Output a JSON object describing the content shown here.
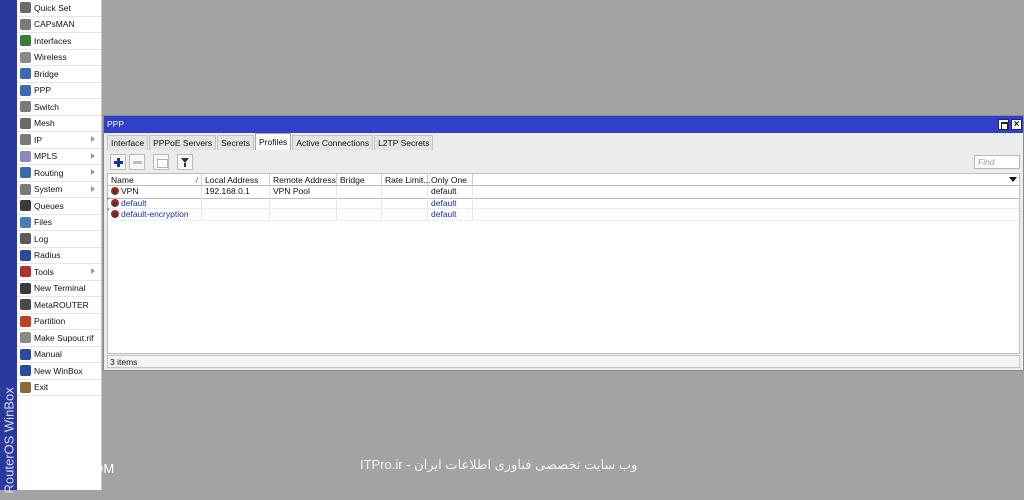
{
  "brand": {
    "text": "RouterOS WinBox"
  },
  "menu": {
    "items": [
      {
        "label": "Quick Set",
        "icon": "quick-set-icon",
        "color": "#6a6a6a",
        "submenu": false
      },
      {
        "label": "CAPsMAN",
        "icon": "capsman-icon",
        "color": "#7a7a7a",
        "submenu": false
      },
      {
        "label": "Interfaces",
        "icon": "interfaces-icon",
        "color": "#3a7a3a",
        "submenu": false
      },
      {
        "label": "Wireless",
        "icon": "wireless-icon",
        "color": "#8a8a8a",
        "submenu": false
      },
      {
        "label": "Bridge",
        "icon": "bridge-icon",
        "color": "#3a6ab0",
        "submenu": false
      },
      {
        "label": "PPP",
        "icon": "ppp-icon",
        "color": "#3a6ab0",
        "submenu": false
      },
      {
        "label": "Switch",
        "icon": "switch-icon",
        "color": "#7a7a7a",
        "submenu": false
      },
      {
        "label": "Mesh",
        "icon": "mesh-icon",
        "color": "#6a6a6a",
        "submenu": false
      },
      {
        "label": "IP",
        "icon": "ip-icon",
        "color": "#7a7a7a",
        "submenu": true
      },
      {
        "label": "MPLS",
        "icon": "mpls-icon",
        "color": "#8a8ac0",
        "submenu": true
      },
      {
        "label": "Routing",
        "icon": "routing-icon",
        "color": "#3a6ab0",
        "submenu": true
      },
      {
        "label": "System",
        "icon": "system-icon",
        "color": "#7a7a7a",
        "submenu": true
      },
      {
        "label": "Queues",
        "icon": "queues-icon",
        "color": "#3a3a3a",
        "submenu": false
      },
      {
        "label": "Files",
        "icon": "files-icon",
        "color": "#4a7ac0",
        "submenu": false
      },
      {
        "label": "Log",
        "icon": "log-icon",
        "color": "#5a5a5a",
        "submenu": false
      },
      {
        "label": "Radius",
        "icon": "radius-icon",
        "color": "#2a4aa0",
        "submenu": false
      },
      {
        "label": "Tools",
        "icon": "tools-icon",
        "color": "#b03030",
        "submenu": true
      },
      {
        "label": "New Terminal",
        "icon": "terminal-icon",
        "color": "#3a3a3a",
        "submenu": false
      },
      {
        "label": "MetaROUTER",
        "icon": "metarouter-icon",
        "color": "#4a4a4a",
        "submenu": false
      },
      {
        "label": "Partition",
        "icon": "partition-icon",
        "color": "#c04020",
        "submenu": false
      },
      {
        "label": "Make Supout.rif",
        "icon": "supout-icon",
        "color": "#8a8a8a",
        "submenu": false
      },
      {
        "label": "Manual",
        "icon": "manual-icon",
        "color": "#2a4aa0",
        "submenu": false
      },
      {
        "label": "New WinBox",
        "icon": "winbox-icon",
        "color": "#2a4aa0",
        "submenu": false
      },
      {
        "label": "Exit",
        "icon": "exit-icon",
        "color": "#8a6a3a",
        "submenu": false
      }
    ]
  },
  "window": {
    "title": "PPP",
    "tabs": [
      "Interface",
      "PPPoE Servers",
      "Secrets",
      "Profiles",
      "Active Connections",
      "L2TP Secrets"
    ],
    "active_tab": "Profiles",
    "find_placeholder": "Find",
    "columns": [
      "Name",
      "Local Address",
      "Remote Address",
      "Bridge",
      "Rate Limit...",
      "Only One"
    ],
    "sort_indicator": "/",
    "rows": [
      {
        "marker": "",
        "name": "VPN",
        "local_address": "192.168.0.1",
        "remote_address": "VPN Pool",
        "bridge": "",
        "rate_limit": "",
        "only_one": "default",
        "is_default": false
      },
      {
        "marker": "*",
        "name": "default",
        "local_address": "",
        "remote_address": "",
        "bridge": "",
        "rate_limit": "",
        "only_one": "default",
        "is_default": true
      },
      {
        "marker": "*",
        "name": "default-encryption",
        "local_address": "",
        "remote_address": "",
        "bridge": "",
        "rate_limit": "",
        "only_one": "default",
        "is_default": true
      }
    ],
    "status": "3 items"
  },
  "watermarks": {
    "left": "TOSINSO.COM",
    "center": "ITPro.ir - وب سایت تخصصی فناوری اطلاعات ایران"
  },
  "colors": {
    "titlebar": "#3040c8",
    "brand_strip": "#2a3a9c",
    "default_text": "#1c2ca8",
    "desktop": "#a3a3a3"
  }
}
